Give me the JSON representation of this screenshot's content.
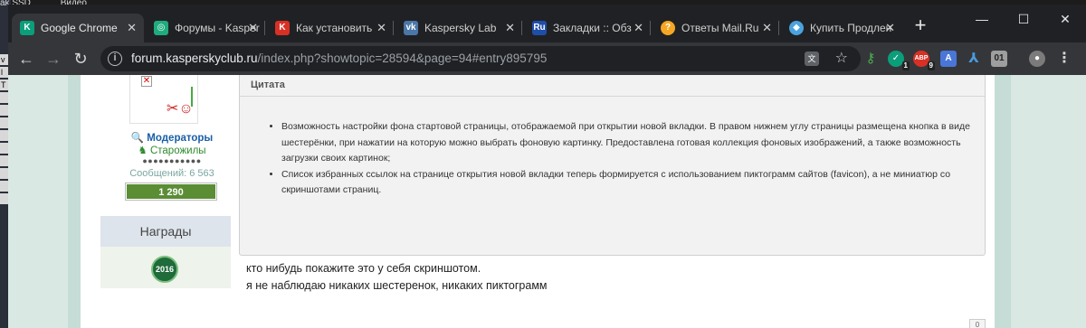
{
  "desktop": {
    "top_items": [
      "ak SSD",
      "Видео"
    ],
    "side_letters": [
      "v",
      "l",
      "T",
      "",
      "",
      "",
      "",
      "",
      "",
      "",
      "",
      ""
    ]
  },
  "tabs": [
    {
      "title": "Google Chrome",
      "icon": "kaspersky-k-icon",
      "color": "#0b9e7a",
      "active": true
    },
    {
      "title": "Форумы - Kasper",
      "icon": "forum-icon",
      "color": "#1eab7d",
      "active": false
    },
    {
      "title": "Как установить",
      "icon": "kaspersky-red-icon",
      "color": "#d93025",
      "active": false
    },
    {
      "title": "Kaspersky Lab",
      "icon": "vk-icon",
      "color": "#4a76a8",
      "active": false
    },
    {
      "title": "Закладки :: Обз",
      "icon": "ru-icon",
      "color": "#1f4ea8",
      "active": false
    },
    {
      "title": "Ответы Mail.Ru",
      "icon": "question-icon",
      "color": "#f5a623",
      "active": false
    },
    {
      "title": "Купить Продлен",
      "icon": "shop-icon",
      "color": "#4aa3df",
      "active": false
    }
  ],
  "address": {
    "host": "forum.kasperskyclub.ru",
    "path": "/index.php?showtopic=28594&page=94#entry895795"
  },
  "extensions": {
    "badge1": "1",
    "badge2": "9",
    "ext_text": "01"
  },
  "profile": {
    "role_mod": "Модераторы",
    "role_old": "Старожилы",
    "dots": "●●●●●●●●●●●",
    "messages": "Сообщений: 6 563",
    "reputation": "1 290",
    "awards_title": "Награды",
    "medal": "2016"
  },
  "quote": {
    "title": "Цитата",
    "items": [
      "Возможность настройки фона стартовой страницы, отображаемой при открытии новой вкладки. В правом нижнем углу страницы размещена кнопка в виде шестерёнки, при нажатии на которую можно выбрать фоновую картинку. Предоставлена готовая коллекция фоновых изображений, а также возможность загрузки своих картинок;",
      "Список избранных ссылок на странице открытия новой вкладки теперь формируется с использованием пиктограмм сайтов (favicon), а не миниатюр со скриншотами страниц."
    ]
  },
  "post": {
    "line1": "кто нибудь покажите это у себя скриншотом.",
    "line2": "я не наблюдаю никаких шестеренок, никаких пиктограмм"
  },
  "counter": "0"
}
